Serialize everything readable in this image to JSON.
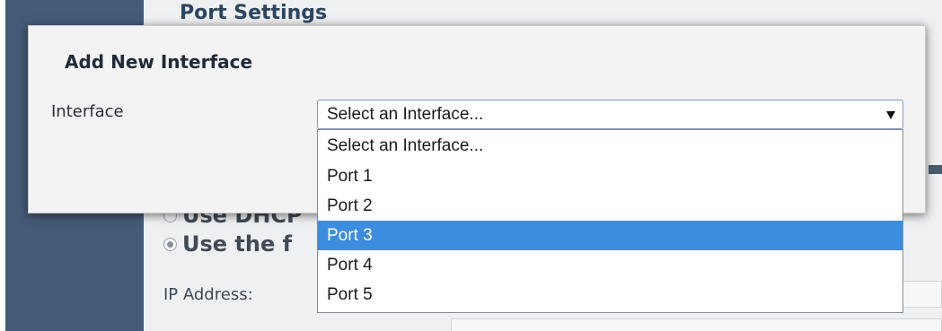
{
  "background": {
    "section_title": "Port Settings",
    "radio_options": [
      {
        "label": "Use DHCP",
        "checked": false
      },
      {
        "label": "Use the f",
        "checked": true
      }
    ],
    "ip_address_label": "IP Address:"
  },
  "modal": {
    "title": "Add New Interface",
    "interface_label": "Interface",
    "select": {
      "selected_value": "Select an Interface...",
      "highlighted_option": "Port 3",
      "options": [
        "Select an Interface...",
        "Port 1",
        "Port 2",
        "Port 3",
        "Port 4",
        "Port 5"
      ]
    }
  },
  "colors": {
    "sidebar": "#445b78",
    "highlight": "#3c8ce0",
    "modal_background": "#f3f3f3"
  }
}
